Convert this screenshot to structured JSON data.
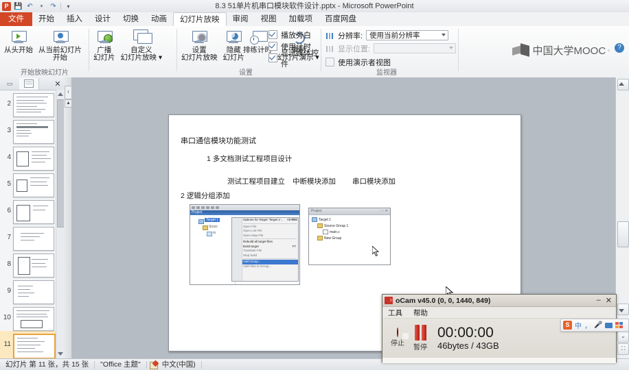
{
  "window": {
    "title": "8.3 51单片机串口模块软件设计.pptx  -  Microsoft PowerPoint",
    "app_icon": "P",
    "quick_access": [
      {
        "name": "save-icon",
        "glyph": "Ὃe"
      },
      {
        "name": "undo-icon",
        "glyph": "↶"
      },
      {
        "name": "redo-icon",
        "glyph": "↷"
      },
      {
        "name": "customize-qat-icon",
        "glyph": "▾"
      }
    ]
  },
  "ribbon": {
    "tabs": [
      {
        "label": "文件",
        "active": false,
        "kind": "file"
      },
      {
        "label": "开始",
        "active": false
      },
      {
        "label": "插入",
        "active": false
      },
      {
        "label": "设计",
        "active": false
      },
      {
        "label": "切换",
        "active": false
      },
      {
        "label": "动画",
        "active": false
      },
      {
        "label": "幻灯片放映",
        "active": true
      },
      {
        "label": "审阅",
        "active": false
      },
      {
        "label": "视图",
        "active": false
      },
      {
        "label": "加载项",
        "active": false
      },
      {
        "label": "百度网盘",
        "active": false
      }
    ],
    "groups": {
      "start_show": {
        "label": "开始放映幻灯片",
        "buttons": [
          {
            "name": "from-beginning",
            "line1": "从头开始",
            "line2": ""
          },
          {
            "name": "from-current-slide",
            "line1": "从当前幻灯片",
            "line2": "开始"
          },
          {
            "name": "broadcast-slide-show",
            "line1": "广播",
            "line2": "幻灯片"
          },
          {
            "name": "custom-slide-show",
            "line1": "自定义",
            "line2": "幻灯片放映 ▾"
          }
        ]
      },
      "setup": {
        "label": "设置",
        "buttons": [
          {
            "name": "set-up-slide-show",
            "line1": "设置",
            "line2": "幻灯片放映"
          },
          {
            "name": "hide-slide",
            "line1": "隐藏",
            "line2": "幻灯片"
          },
          {
            "name": "rehearse-timings",
            "line1": "排练计时",
            "line2": ""
          },
          {
            "name": "record-slide-show",
            "line1": "录制",
            "line2": "幻灯片演示 ▾"
          }
        ],
        "checkboxes": [
          {
            "label": "播放旁白",
            "checked": true
          },
          {
            "label": "使用计时",
            "checked": true
          },
          {
            "label": "显示媒体控件",
            "checked": true
          }
        ]
      },
      "monitors": {
        "label": "监视器",
        "resolution_label": "分辨率:",
        "resolution_value": "使用当前分辨率",
        "show_on_label": "显示位置:",
        "show_on_value": "",
        "presenter_view_label": "使用演示者视图",
        "presenter_view_checked": false
      }
    },
    "branding": {
      "text": "中国大学MOOC",
      "sup": "◦"
    },
    "help_icon": "?"
  },
  "thumbnails": {
    "close_icon": "✕",
    "slides": [
      {
        "number": "2",
        "selected": false
      },
      {
        "number": "3",
        "selected": false
      },
      {
        "number": "4",
        "selected": false
      },
      {
        "number": "5",
        "selected": false
      },
      {
        "number": "6",
        "selected": false
      },
      {
        "number": "7",
        "selected": false
      },
      {
        "number": "8",
        "selected": false
      },
      {
        "number": "9",
        "selected": false
      },
      {
        "number": "10",
        "selected": false
      },
      {
        "number": "11",
        "selected": true
      }
    ]
  },
  "slide": {
    "title": "串口通信模块功能测试",
    "line_1": "1 多文档测试工程项目设计",
    "columns": [
      "测试工程项目建立",
      "中断模块添加",
      "串口模块添加"
    ],
    "line_2": "2 逻辑分组添加",
    "shot_left": {
      "window_title": "Project",
      "tree_root": "Target 1",
      "context_menu": [
        {
          "label": "Options for Target 'Target 1'...",
          "shortcut": "Alt+F7",
          "enabled": true
        },
        {
          "label": "Open File",
          "shortcut": "",
          "enabled": false
        },
        {
          "label": "Open List File",
          "shortcut": "",
          "enabled": false
        },
        {
          "label": "Open Map File",
          "shortcut": "",
          "enabled": false
        },
        {
          "label": "Rebuild all target files",
          "shortcut": "",
          "enabled": true
        },
        {
          "label": "Build target",
          "shortcut": "F7",
          "enabled": true
        },
        {
          "label": "Translate File",
          "shortcut": "",
          "enabled": false
        },
        {
          "label": "Stop build",
          "shortcut": "",
          "enabled": false
        },
        {
          "label": "Add Group...",
          "shortcut": "",
          "enabled": true,
          "highlighted": true
        },
        {
          "label": "Add Files to Group...",
          "shortcut": "",
          "enabled": false
        }
      ]
    },
    "shot_right": {
      "window_title": "Project",
      "tree": [
        {
          "label": "Target 1",
          "depth": 0
        },
        {
          "label": "Source Group 1",
          "depth": 1
        },
        {
          "label": "main.c",
          "depth": 2
        },
        {
          "label": "New Group",
          "depth": 1
        }
      ]
    }
  },
  "status_bar": {
    "slide_count": "幻灯片 第 11 张，共 15 张",
    "theme": "\"Office 主题\"",
    "language": "中文(中国)"
  },
  "ocam": {
    "title": "oCam v45.0 (0, 0, 1440, 849)",
    "minimize": "–",
    "close": "✕",
    "menus": [
      "工具",
      "帮助"
    ],
    "stop_label": "停止",
    "pause_label": "暂停",
    "time": "00:00:00",
    "size": "46bytes / 43GB"
  },
  "ime": {
    "logo": "S",
    "mode": "中",
    "punctuation": "，",
    "mic_icon": "Ἲ4",
    "keyboard_icon": "keyboard",
    "tools_icon": "tools"
  },
  "colors": {
    "accent_orange": "#d24726",
    "selected_thumb": "#fde9bf",
    "ribbon_bg": "#eef0f2",
    "record_red": "#b21d12"
  }
}
